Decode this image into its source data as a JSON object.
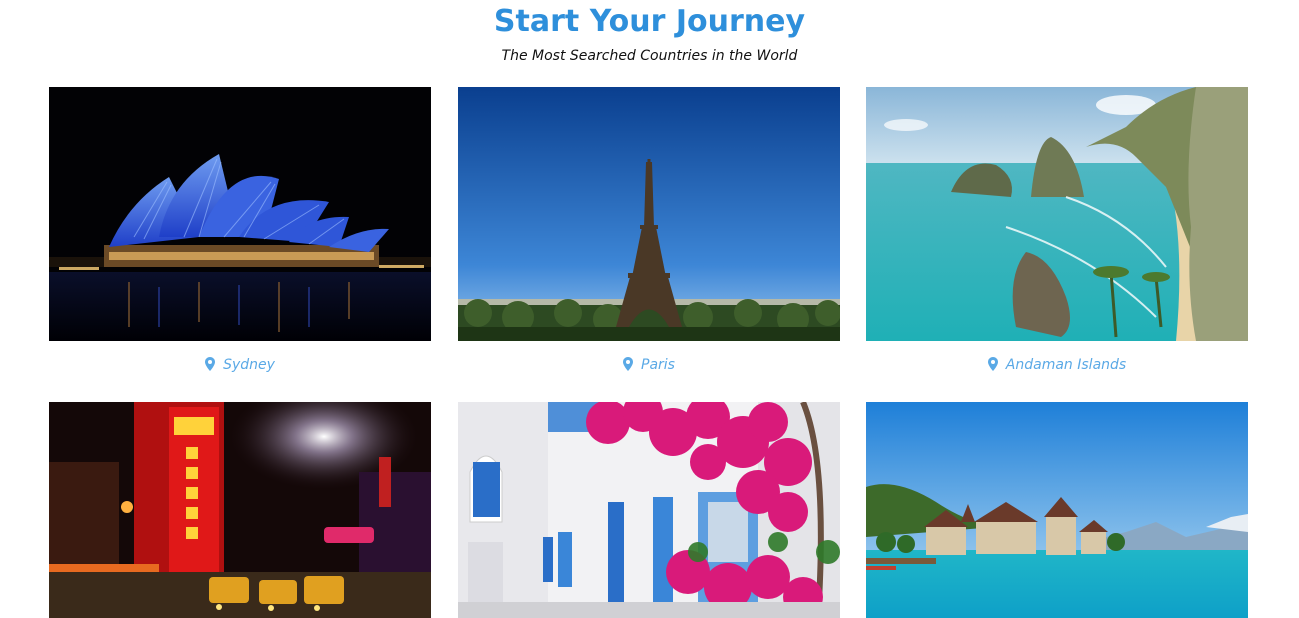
{
  "header": {
    "title": "Start Your Journey",
    "subtitle": "The Most Searched Countries in the World"
  },
  "destinations": [
    {
      "name": "Sydney",
      "icon": "map-pin-icon"
    },
    {
      "name": "Paris",
      "icon": "map-pin-icon"
    },
    {
      "name": "Andaman Islands",
      "icon": "map-pin-icon"
    },
    {
      "name": "",
      "icon": ""
    },
    {
      "name": "",
      "icon": ""
    },
    {
      "name": "",
      "icon": ""
    }
  ],
  "colors": {
    "title": "#2e8fdb",
    "caption": "#5aa9e6"
  }
}
